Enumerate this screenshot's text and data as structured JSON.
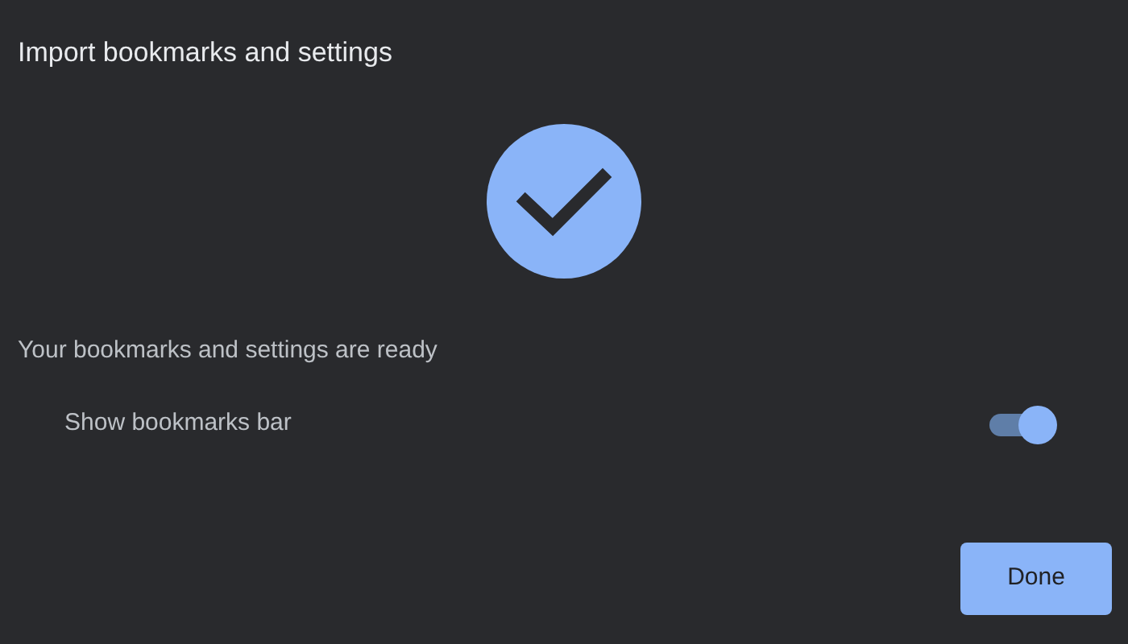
{
  "dialog": {
    "title": "Import bookmarks and settings",
    "message": "Your bookmarks and settings are ready",
    "options": [
      {
        "label": "Show bookmarks bar",
        "on": true
      }
    ],
    "buttons": [
      "Done"
    ]
  }
}
